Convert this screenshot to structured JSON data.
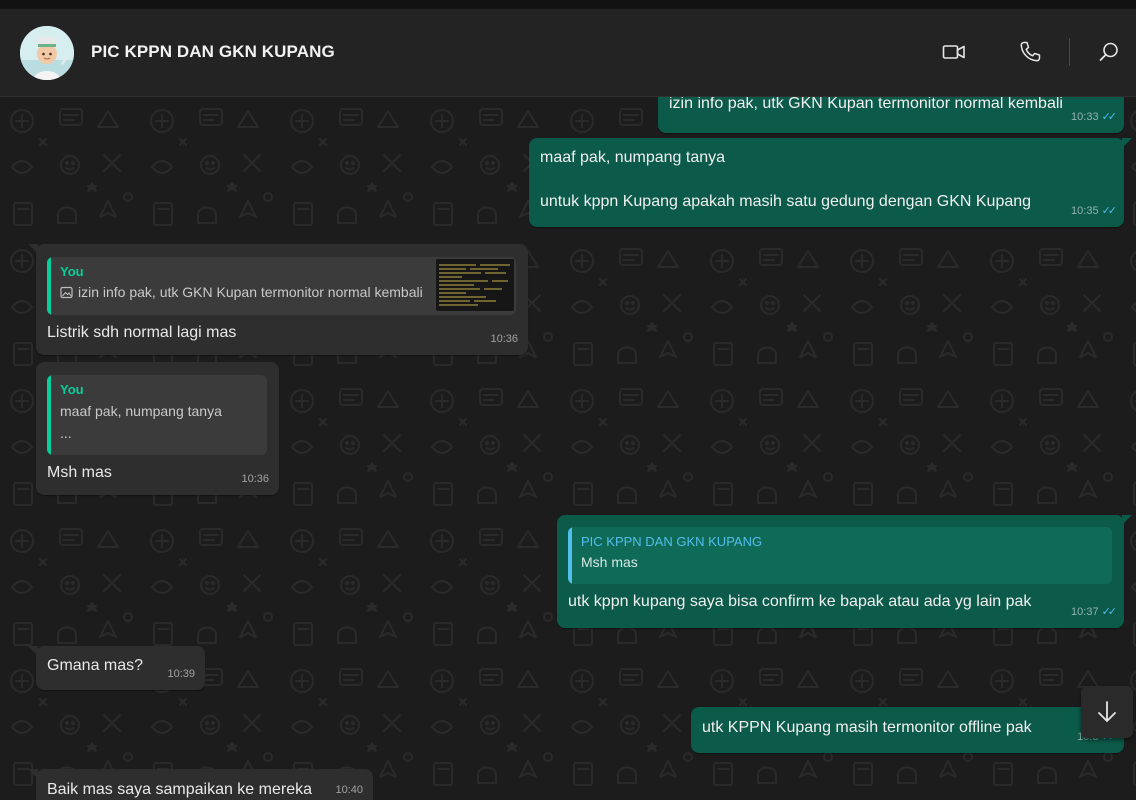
{
  "header": {
    "chat_title": "PIC KPPN DAN GKN KUPANG",
    "icons": [
      "video-call-icon",
      "voice-call-icon",
      "search-icon"
    ]
  },
  "colors": {
    "incoming_bubble": "#2e2e2e",
    "outgoing_bubble": "#0b5a4a",
    "quote_accent_you": "#06cf9c",
    "quote_accent_contact": "#53bdeb",
    "read_ticks": "#53bdeb"
  },
  "messages": [
    {
      "direction": "out",
      "text": "izin info pak, utk GKN Kupan termonitor normal kembali",
      "time": "10:33",
      "status": "read"
    },
    {
      "direction": "out",
      "text_line1": "maaf pak, numpang tanya",
      "text_line2": "untuk kppn Kupang apakah masih satu gedung dengan GKN Kupang",
      "time": "10:35",
      "status": "read"
    },
    {
      "direction": "in",
      "quote": {
        "author": "You",
        "text": "izin info pak, utk GKN Kupan termonitor normal kembali",
        "has_image": true
      },
      "text": "Listrik sdh normal lagi mas",
      "time": "10:36"
    },
    {
      "direction": "in",
      "quote": {
        "author": "You",
        "line1": "maaf pak, numpang tanya",
        "line2": "..."
      },
      "text": "Msh mas",
      "time": "10:36"
    },
    {
      "direction": "out",
      "quote": {
        "author": "PIC KPPN DAN GKN KUPANG",
        "text": "Msh mas"
      },
      "text": "utk kppn kupang saya bisa confirm ke bapak atau ada yg lain pak",
      "time": "10:37",
      "status": "read"
    },
    {
      "direction": "in",
      "text": "Gmana mas?",
      "time": "10:39"
    },
    {
      "direction": "out",
      "text": "utk KPPN Kupang masih termonitor offline pak",
      "time": "10:3",
      "status": "read"
    },
    {
      "direction": "in",
      "text": "Baik mas saya sampaikan ke mereka",
      "time": "10:40"
    }
  ]
}
